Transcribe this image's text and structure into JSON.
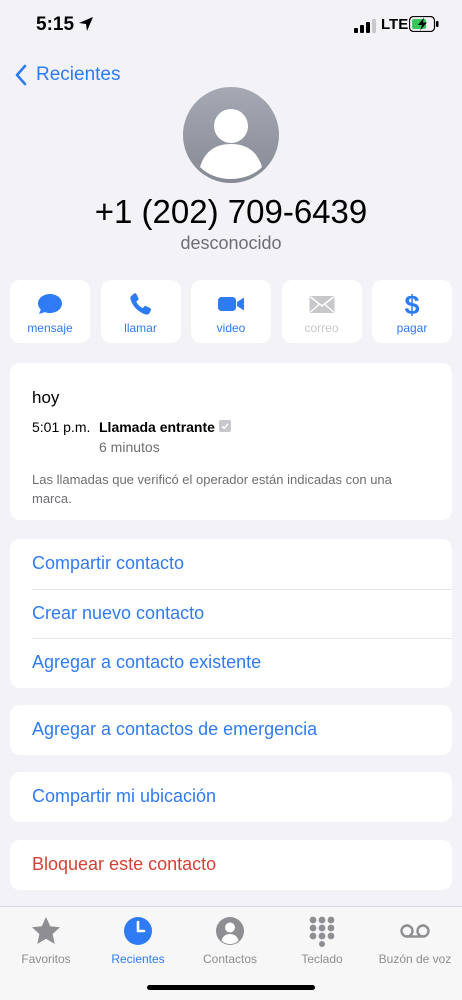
{
  "status_bar": {
    "time": "5:15",
    "network": "LTE"
  },
  "nav": {
    "back_label": "Recientes"
  },
  "contact": {
    "number": "+1 (202) 709-6439",
    "subtitle": "desconocido"
  },
  "actions": [
    {
      "label": "mensaje",
      "icon": "message-bubble-icon",
      "enabled": true
    },
    {
      "label": "llamar",
      "icon": "phone-icon",
      "enabled": true
    },
    {
      "label": "video",
      "icon": "video-camera-icon",
      "enabled": true
    },
    {
      "label": "correo",
      "icon": "mail-envelope-icon",
      "enabled": false
    },
    {
      "label": "pagar",
      "icon": "dollar-icon",
      "enabled": true
    }
  ],
  "calls": {
    "day": "hoy",
    "entries": [
      {
        "time": "5:01 p.m.",
        "type": "Llamada entrante",
        "duration": "6 minutos"
      }
    ],
    "note": "Las llamadas que verificó el operador están indicadas con una marca."
  },
  "options": {
    "group1": [
      "Compartir contacto",
      "Crear nuevo contacto",
      "Agregar a contacto existente"
    ],
    "emergency": "Agregar a contactos de emergencia",
    "share_location": "Compartir mi ubicación",
    "block": "Bloquear este contacto"
  },
  "tabs": [
    {
      "label": "Favoritos",
      "icon": "star-icon"
    },
    {
      "label": "Recientes",
      "icon": "clock-icon",
      "active": true
    },
    {
      "label": "Contactos",
      "icon": "person-circle-icon"
    },
    {
      "label": "Teclado",
      "icon": "keypad-icon"
    },
    {
      "label": "Buzón de voz",
      "icon": "voicemail-icon"
    }
  ],
  "colors": {
    "accent": "#2f7bf5",
    "danger": "#d64135",
    "background": "#f2f2f7",
    "secondary_text": "#6e6e73",
    "battery_charging": "#34c759"
  }
}
